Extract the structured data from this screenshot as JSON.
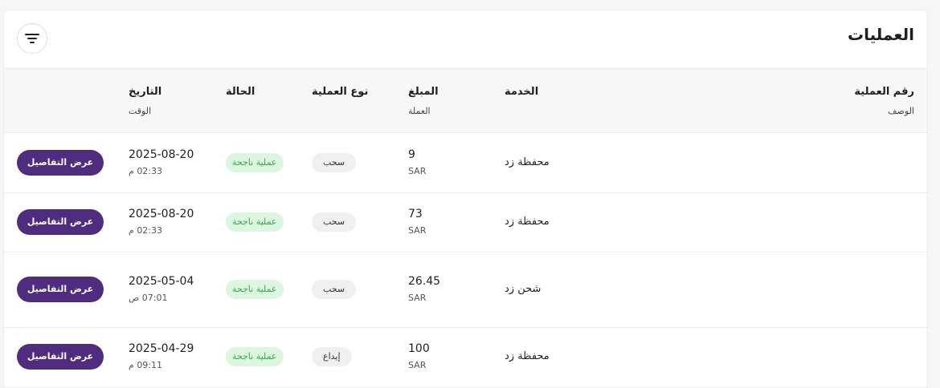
{
  "page": {
    "title": "العمليات"
  },
  "icons": {
    "filter": "filter-icon"
  },
  "colors": {
    "primary": "#4f2c7d",
    "success_bg": "#ddf6e0",
    "success_text": "#3aa655"
  },
  "table": {
    "headers": {
      "number": "رقم العملية",
      "description": "الوصف",
      "service": "الخدمة",
      "amount": "المبلغ",
      "currency": "العملة",
      "type": "نوع العملية",
      "status": "الحالة",
      "date": "التاريخ",
      "time": "الوقت"
    },
    "rows": [
      {
        "service": "محفظة زد",
        "amount": "9",
        "currency": "SAR",
        "type": "سحب",
        "status": "عملية ناجحة",
        "date": "2025-08-20",
        "time": "02:33 م",
        "action": "عرض التفاصيل"
      },
      {
        "service": "محفظة زد",
        "amount": "73",
        "currency": "SAR",
        "type": "سحب",
        "status": "عملية ناجحة",
        "date": "2025-08-20",
        "time": "02:33 م",
        "action": "عرض التفاصيل"
      },
      {
        "service": "شحن زد",
        "amount": "26.45",
        "currency": "SAR",
        "type": "سحب",
        "status": "عملية ناجحة",
        "date": "2025-05-04",
        "time": "07:01 ص",
        "action": "عرض التفاصيل"
      },
      {
        "service": "محفظة زد",
        "amount": "100",
        "currency": "SAR",
        "type": "إيداع",
        "status": "عملية ناجحة",
        "date": "2025-04-29",
        "time": "09:11 م",
        "action": "عرض التفاصيل"
      }
    ]
  }
}
